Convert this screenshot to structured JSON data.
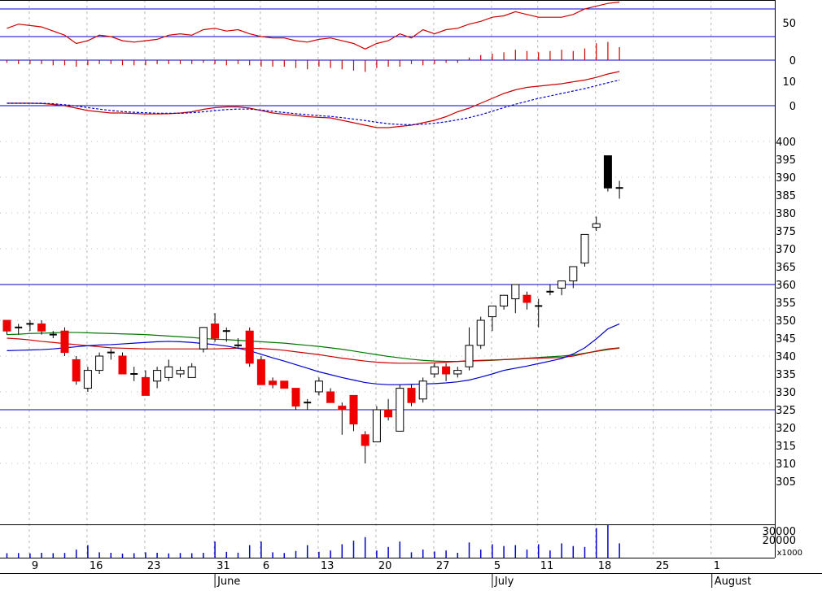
{
  "colors": {
    "background": "#ffffff",
    "grid": "#b8b8b8",
    "frame": "#000000",
    "level_line": "#0000cc",
    "candle_down": "#ee0000",
    "candle_up": "#ffffff",
    "ma_fast": "#0000cc",
    "ma_mid": "#cc0000",
    "ma_slow": "#007700",
    "volume": "#0000cc",
    "osc_line": "#cc0000",
    "osc_signal": "#0000cc"
  },
  "chart_data": {
    "type": "candlestick",
    "days": [
      "05-07",
      "05-08",
      "05-09",
      "05-10",
      "05-13",
      "05-14",
      "05-15",
      "05-16",
      "05-17",
      "05-20",
      "05-21",
      "05-22",
      "05-23",
      "05-24",
      "05-27",
      "05-28",
      "05-29",
      "05-30",
      "05-31",
      "06-03",
      "06-04",
      "06-05",
      "06-06",
      "06-07",
      "06-10",
      "06-11",
      "06-12",
      "06-13",
      "06-14",
      "06-17",
      "06-18",
      "06-19",
      "06-20",
      "06-21",
      "06-24",
      "06-25",
      "06-26",
      "06-27",
      "06-28",
      "07-01",
      "07-02",
      "07-03",
      "07-04",
      "07-05",
      "07-08",
      "07-09",
      "07-10",
      "07-11",
      "07-12",
      "07-15",
      "07-16",
      "07-17",
      "07-18",
      "07-19",
      "07-22",
      "07-23"
    ],
    "ohlc": [
      [
        350,
        350,
        346,
        347
      ],
      [
        348,
        349,
        346,
        348
      ],
      [
        349,
        350,
        347,
        349
      ],
      [
        349,
        350,
        346,
        347
      ],
      [
        346,
        347,
        345,
        346
      ],
      [
        347,
        348,
        340,
        341
      ],
      [
        339,
        340,
        332,
        333
      ],
      [
        331,
        337,
        330,
        336
      ],
      [
        336,
        341,
        335,
        340
      ],
      [
        341,
        342,
        339,
        341
      ],
      [
        340,
        341,
        335,
        335
      ],
      [
        335,
        337,
        333,
        335
      ],
      [
        334,
        336,
        329,
        329
      ],
      [
        333,
        337,
        331,
        336
      ],
      [
        334,
        339,
        333,
        337
      ],
      [
        335,
        337,
        334,
        336
      ],
      [
        334,
        338,
        334,
        337
      ],
      [
        342,
        346,
        341,
        348
      ],
      [
        349,
        352,
        344,
        345
      ],
      [
        347,
        348,
        344,
        347
      ],
      [
        343,
        345,
        342,
        343
      ],
      [
        347,
        348,
        337,
        338
      ],
      [
        339,
        340,
        332,
        332
      ],
      [
        333,
        334,
        331,
        332
      ],
      [
        333,
        333,
        331,
        331
      ],
      [
        331,
        331,
        325,
        326
      ],
      [
        327,
        328,
        325,
        327
      ],
      [
        330,
        334,
        329,
        333
      ],
      [
        330,
        331,
        327,
        327
      ],
      [
        326,
        327,
        318,
        325
      ],
      [
        329,
        329,
        319,
        321
      ],
      [
        318,
        319,
        310,
        315
      ],
      [
        316,
        326,
        316,
        325
      ],
      [
        325,
        328,
        322,
        323
      ],
      [
        319,
        332,
        319,
        331
      ],
      [
        331,
        332,
        326,
        327
      ],
      [
        328,
        334,
        327,
        333
      ],
      [
        335,
        338,
        334,
        337
      ],
      [
        337,
        338,
        333,
        335
      ],
      [
        335,
        337,
        334,
        336
      ],
      [
        337,
        348,
        336,
        343
      ],
      [
        343,
        351,
        342,
        350
      ],
      [
        351,
        354,
        347,
        354
      ],
      [
        354,
        357,
        353,
        357
      ],
      [
        356,
        360,
        352,
        360
      ],
      [
        357,
        358,
        353,
        355
      ],
      [
        354,
        356,
        348,
        354
      ],
      [
        358,
        360,
        357,
        358
      ],
      [
        359,
        361,
        357,
        361
      ],
      [
        361,
        365,
        359,
        365
      ],
      [
        366,
        374,
        365,
        374
      ],
      [
        376,
        379,
        375,
        377
      ],
      [
        396,
        396,
        386,
        387
      ],
      [
        387,
        389,
        384,
        387
      ]
    ],
    "ma_fast": [
      341.5,
      341.6,
      341.7,
      341.8,
      342.0,
      342.3,
      342.6,
      342.9,
      343.1,
      343.2,
      343.4,
      343.6,
      343.8,
      344.0,
      344.1,
      344.0,
      343.8,
      343.5,
      343.2,
      342.8,
      342.2,
      341.5,
      340.5,
      339.5,
      338.6,
      337.6,
      336.6,
      335.6,
      334.8,
      334.0,
      333.3,
      332.6,
      332.2,
      332.0,
      332.0,
      332.1,
      332.2,
      332.3,
      332.5,
      332.8,
      333.3,
      334.1,
      335.0,
      336.0,
      336.6,
      337.2,
      337.9,
      338.6,
      339.3,
      340.6,
      342.3,
      344.8,
      347.6,
      349.0
    ],
    "ma_mid": [
      345.0,
      344.8,
      344.5,
      344.1,
      343.8,
      343.5,
      343.2,
      342.9,
      342.6,
      342.3,
      342.2,
      342.1,
      342.0,
      342.0,
      342.0,
      342.0,
      342.0,
      342.0,
      342.0,
      342.1,
      342.2,
      342.2,
      342.1,
      341.9,
      341.6,
      341.2,
      340.8,
      340.4,
      339.9,
      339.4,
      339.0,
      338.6,
      338.3,
      338.1,
      338.0,
      338.0,
      338.0,
      338.1,
      338.3,
      338.5,
      338.7,
      338.8,
      338.9,
      339.0,
      339.1,
      339.3,
      339.4,
      339.5,
      339.6,
      340.0,
      340.7,
      341.4,
      342.0,
      342.3
    ],
    "ma_slow": [
      346.0,
      346.1,
      346.3,
      346.4,
      346.5,
      346.6,
      346.6,
      346.5,
      346.4,
      346.3,
      346.2,
      346.1,
      346.0,
      345.8,
      345.6,
      345.4,
      345.2,
      344.9,
      344.7,
      344.6,
      344.4,
      344.2,
      344.0,
      343.8,
      343.6,
      343.3,
      343.0,
      342.7,
      342.3,
      341.9,
      341.4,
      340.9,
      340.4,
      339.9,
      339.5,
      339.1,
      338.8,
      338.6,
      338.5,
      338.5,
      338.6,
      338.7,
      338.8,
      339.0,
      339.2,
      339.4,
      339.6,
      339.8,
      340.0,
      340.3,
      340.8,
      341.3,
      341.8,
      342.2
    ],
    "volume": [
      5000,
      5200,
      4800,
      5500,
      5000,
      5300,
      9000,
      14000,
      6000,
      5500,
      4500,
      5000,
      6000,
      5500,
      4800,
      5200,
      5000,
      5400,
      18000,
      6500,
      5600,
      14000,
      18000,
      6000,
      5200,
      7500,
      14000,
      6500,
      8000,
      15000,
      19000,
      23000,
      8000,
      12000,
      18000,
      6000,
      9000,
      7000,
      8000,
      5500,
      17000,
      9000,
      15000,
      13000,
      14000,
      9000,
      15000,
      8000,
      16000,
      13000,
      12000,
      33000,
      37000,
      16000
    ],
    "osc_top": [
      56,
      59,
      58,
      57,
      54,
      51,
      45,
      47,
      51,
      50,
      47,
      46,
      47,
      48,
      51,
      52,
      51,
      55,
      56,
      54,
      55,
      52,
      50,
      49,
      49,
      47,
      46,
      48,
      49,
      47,
      45,
      41,
      45,
      47,
      52,
      49,
      55,
      52,
      55,
      56,
      59,
      61,
      64,
      65,
      68,
      66,
      64,
      64,
      64,
      66,
      70,
      72,
      74,
      75
    ],
    "osc_mid": [
      -2,
      -3,
      -3,
      -3,
      -4,
      -4,
      -5,
      -4,
      -3,
      -3,
      -4,
      -4,
      -4,
      -3,
      -3,
      -3,
      -3,
      -2,
      -3,
      -4,
      -3,
      -4,
      -5,
      -5,
      -5,
      -6,
      -7,
      -5,
      -6,
      -7,
      -8,
      -9,
      -6,
      -5,
      -5,
      -3,
      -4,
      -3,
      -2,
      -2,
      2,
      4,
      5,
      6,
      8,
      7,
      6,
      7,
      8,
      7,
      9,
      13,
      14,
      10
    ],
    "osc_line": [
      1.0,
      1.0,
      1.0,
      0.9,
      0.5,
      0,
      -1,
      -2,
      -2.5,
      -3,
      -3,
      -3.2,
      -3.4,
      -3.4,
      -3.3,
      -3,
      -2.5,
      -1.5,
      -0.8,
      -0.5,
      -0.5,
      -1,
      -2,
      -3,
      -3.5,
      -4,
      -4.5,
      -4.8,
      -5,
      -6,
      -7,
      -8,
      -9,
      -9,
      -8.5,
      -8,
      -7,
      -6,
      -4.5,
      -2.5,
      -1,
      1,
      3,
      5,
      6.5,
      7.5,
      8,
      8.5,
      9,
      9.8,
      10.5,
      11.6,
      13,
      14
    ],
    "osc_signal": [
      1.0,
      1.0,
      1.0,
      1.0,
      0.8,
      0.4,
      -0.1,
      -0.8,
      -1.4,
      -2,
      -2.4,
      -2.7,
      -2.9,
      -3.1,
      -3.1,
      -3.1,
      -2.9,
      -2.5,
      -2.0,
      -1.6,
      -1.4,
      -1.4,
      -1.8,
      -2.3,
      -2.8,
      -3.3,
      -3.7,
      -4.1,
      -4.4,
      -4.9,
      -5.5,
      -6.1,
      -6.8,
      -7.4,
      -7.7,
      -7.8,
      -7.6,
      -7.2,
      -6.6,
      -5.8,
      -4.9,
      -3.7,
      -2.3,
      -0.8,
      0.6,
      1.8,
      3.0,
      4.0,
      5.0,
      6.0,
      7.0,
      8.2,
      9.4,
      10.5
    ],
    "price_axis": {
      "min": 303,
      "max": 402,
      "ticks": [
        305,
        310,
        315,
        320,
        325,
        330,
        335,
        340,
        345,
        350,
        355,
        360,
        365,
        370,
        375,
        380,
        385,
        390,
        395,
        400
      ]
    },
    "price_levels": [
      360,
      325
    ],
    "volume_axis": {
      "ticks": [
        20000,
        30000
      ],
      "unit_label": "x1000"
    },
    "osc_top_axis": {
      "ticks": [
        50
      ],
      "level": 50,
      "upper_level": 70
    },
    "osc_mid_axis": {
      "ticks": [
        0
      ]
    },
    "osc_bottom_axis": {
      "ticks": [
        10,
        0
      ]
    },
    "x_ticks": [
      "9",
      "16",
      "23",
      "31",
      "6",
      "13",
      "20",
      "27",
      "5",
      "11",
      "18",
      "25",
      "1"
    ],
    "month_labels": [
      "June",
      "July",
      "August"
    ],
    "grid": true
  }
}
